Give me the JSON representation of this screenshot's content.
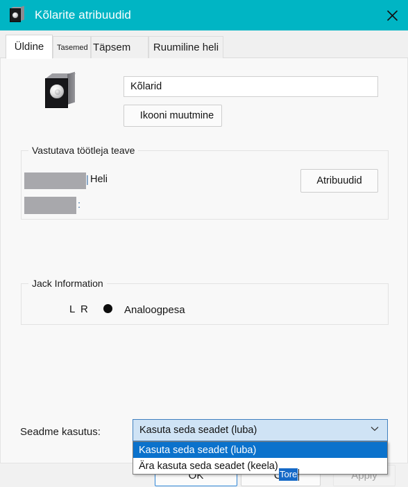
{
  "window": {
    "title": "Kõlarite atribuudid",
    "title_icon": "speaker-icon",
    "close_icon": "close-icon",
    "titlebar_color": "#00b5c4"
  },
  "tabs": [
    {
      "id": "uldine",
      "label": "Üldine",
      "active": true
    },
    {
      "id": "tasemed",
      "label": "Tasemed",
      "active": false
    },
    {
      "id": "tapsem",
      "label": "Täpsem",
      "active": false
    },
    {
      "id": "ruum",
      "label": "Ruumiline heli",
      "active": false
    }
  ],
  "general": {
    "device_icon": "speaker-icon",
    "name_value": "Kõlarid",
    "name_placeholder": "",
    "change_icon_label": "Ikooni muutmine"
  },
  "controller_group": {
    "legend": "Vastutava töötleja teave",
    "row1_redacted": "",
    "row1_suffix": "Heli",
    "row2_redacted": "",
    "row2_suffix": ":",
    "row1_divider": "|",
    "properties_label": "Atribuudid"
  },
  "jack_group": {
    "legend": "Jack Information",
    "channels": "L R",
    "connector_icon": "jack-dot-icon",
    "connector_label": "Analoogpesa"
  },
  "device_usage": {
    "label": "Seadme kasutus:",
    "selected": "Kasuta seda seadet (luba)",
    "chevron_icon": "chevron-down-icon",
    "options": [
      {
        "label": "Kasuta seda seadet (luba)",
        "selected": true
      },
      {
        "label": "Ära kasuta seda seadet (keela)",
        "selected": false
      }
    ]
  },
  "footer": {
    "ok_label": "OK",
    "cancel_label": "Ca",
    "cancel_ime_composition": "Tore",
    "apply_label": "Apply"
  }
}
